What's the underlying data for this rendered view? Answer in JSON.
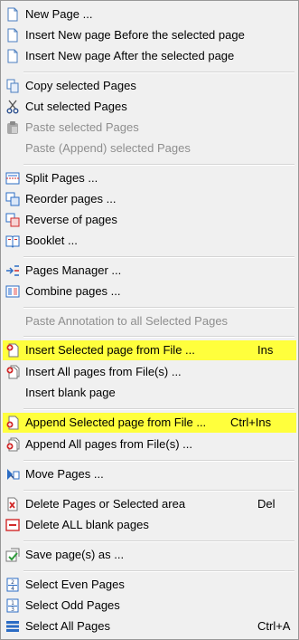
{
  "menu": {
    "new_page": "New Page ...",
    "insert_before": "Insert New page Before the selected page",
    "insert_after": "Insert New page After the selected page",
    "copy": "Copy selected Pages",
    "cut": "Cut selected Pages",
    "paste": "Paste selected Pages",
    "paste_append": "Paste (Append) selected Pages",
    "split": "Split Pages ...",
    "reorder": "Reorder pages ...",
    "reverse": "Reverse of pages",
    "booklet": "Booklet ...",
    "pages_manager": "Pages Manager ...",
    "combine": "Combine pages ...",
    "paste_annotation": "Paste Annotation to all Selected Pages",
    "insert_selected": "Insert Selected page from File ...",
    "insert_selected_shortcut": "Ins",
    "insert_all": "Insert All pages from File(s) ...",
    "insert_blank": "Insert blank page",
    "append_selected": "Append Selected page from File ...",
    "append_selected_shortcut": "Ctrl+Ins",
    "append_all": "Append All pages from File(s) ...",
    "move": "Move Pages ...",
    "delete": "Delete Pages or Selected area",
    "delete_shortcut": "Del",
    "delete_blank": "Delete ALL blank pages",
    "save_as": "Save page(s) as ...",
    "select_even": "Select Even Pages",
    "select_odd": "Select Odd Pages",
    "select_all": "Select All Pages",
    "select_all_shortcut": "Ctrl+A"
  },
  "icons": {
    "new_page": "page-icon",
    "insert_before": "page-icon",
    "insert_after": "page-icon",
    "copy": "copy-icon",
    "cut": "scissors-icon",
    "paste": "clipboard-icon",
    "split": "split-icon",
    "reorder": "reorder-icon",
    "reverse": "reverse-icon",
    "booklet": "booklet-icon",
    "pages_manager": "pages-manager-icon",
    "combine": "combine-icon",
    "insert_selected": "insert-page-icon",
    "insert_all": "insert-pages-icon",
    "append_selected": "append-page-icon",
    "append_all": "append-pages-icon",
    "move": "move-pages-icon",
    "delete": "delete-page-icon",
    "delete_blank": "delete-blank-icon",
    "save_as": "save-pages-icon",
    "select_even": "select-even-icon",
    "select_odd": "select-odd-icon",
    "select_all": "select-all-icon"
  },
  "colors": {
    "highlight": "#ffff3c",
    "menu_background": "#f0f0f0",
    "disabled_text": "#8e8e8e",
    "icon_blue": "#2b6cc4",
    "icon_red": "#d22a2a"
  }
}
